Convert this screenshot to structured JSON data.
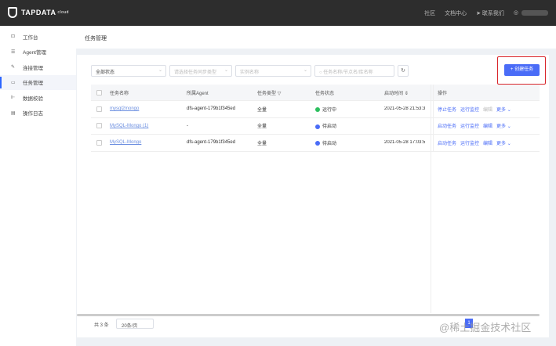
{
  "header": {
    "logo": "TAPDATA",
    "logo_sup": "cloud",
    "nav": [
      "社区",
      "文档中心",
      "联系我们"
    ]
  },
  "sidebar": {
    "items": [
      {
        "label": "工作台",
        "icon": "dashboard-icon",
        "active": false
      },
      {
        "label": "Agent管理",
        "icon": "list-icon",
        "active": false
      },
      {
        "label": "连接管理",
        "icon": "link-icon",
        "active": false
      },
      {
        "label": "任务管理",
        "icon": "task-icon",
        "active": true
      },
      {
        "label": "数据校验",
        "icon": "check-icon",
        "active": false
      },
      {
        "label": "操作日志",
        "icon": "log-icon",
        "active": false
      }
    ]
  },
  "page_title": "任务管理",
  "filters": {
    "status": "全部状态",
    "sync_type_placeholder": "请选择任务同步类型",
    "instance_placeholder": "实例名称",
    "search_placeholder": "任务名称/节点名/库名称"
  },
  "create_button": "+ 创建任务",
  "table": {
    "headers": [
      "任务名称",
      "所属Agent",
      "任务类型",
      "任务状态",
      "启动时间",
      "操作"
    ],
    "rows": [
      {
        "name": "mysql2mongo",
        "agent": "dfs-agent-179b1f345ed",
        "type": "全量",
        "status": "运行中",
        "status_color": "#2dbf5f",
        "time": "2021-05-28 21:53:3",
        "ops": [
          "停止任务",
          "运行监控",
          "编辑",
          "更多 ⌄"
        ],
        "disabled_op": 2
      },
      {
        "name": "MySQL-Mongo (1)",
        "agent": "-",
        "type": "全量",
        "status": "待启动",
        "status_color": "#4a6cf7",
        "time": "",
        "ops": [
          "启动任务",
          "运行监控",
          "编辑",
          "更多 ⌄"
        ],
        "disabled_op": -1
      },
      {
        "name": "MySQL-Mongo",
        "agent": "dfs-agent-179b1f345ed",
        "type": "全量",
        "status": "待启动",
        "status_color": "#4a6cf7",
        "time": "2021-05-28 17:03:5",
        "ops": [
          "启动任务",
          "运行监控",
          "编辑",
          "更多 ⌄"
        ],
        "disabled_op": -1
      }
    ]
  },
  "pagination": {
    "total": "共 3 条",
    "page_size": "20条/页",
    "current": "1"
  },
  "watermark": "@稀土掘金技术社区"
}
